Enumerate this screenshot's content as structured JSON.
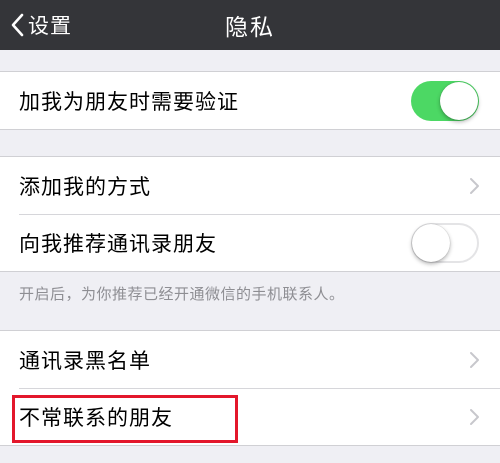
{
  "nav": {
    "back_label": "设置",
    "title": "隐私"
  },
  "group1": {
    "items": [
      {
        "label": "加我为朋友时需要验证",
        "toggle_on": true
      }
    ]
  },
  "group2": {
    "items": [
      {
        "label": "添加我的方式",
        "accessory": "chevron-right-icon"
      },
      {
        "label": "向我推荐通讯录朋友",
        "toggle_on": false
      }
    ],
    "footer_note": "开启后，为你推荐已经开通微信的手机联系人。"
  },
  "group3": {
    "items": [
      {
        "label": "通讯录黑名单",
        "accessory": "chevron-right-icon"
      },
      {
        "label": "不常联系的朋友",
        "accessory": "chevron-right-icon",
        "highlighted": true
      }
    ]
  },
  "colors": {
    "nav_bg": "#343539",
    "toggle_on": "#4cd864",
    "highlight_border": "#e3172b",
    "page_bg": "#efeff4"
  }
}
